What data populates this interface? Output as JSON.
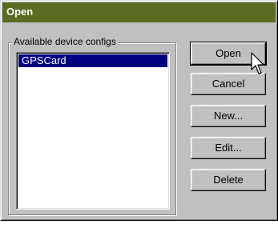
{
  "window": {
    "title": "Open"
  },
  "group": {
    "label": "Available device configs"
  },
  "list": {
    "items": [
      {
        "label": "GPSCard",
        "selected": true
      }
    ]
  },
  "buttons": {
    "open": "Open",
    "cancel": "Cancel",
    "new": "New...",
    "edit": "Edit...",
    "delete": "Delete"
  },
  "colors": {
    "title_bar": "#5b6b22",
    "selection": "#000080",
    "face": "#c0c0c0"
  },
  "icons": {
    "cursor": "arrow-cursor-icon"
  }
}
